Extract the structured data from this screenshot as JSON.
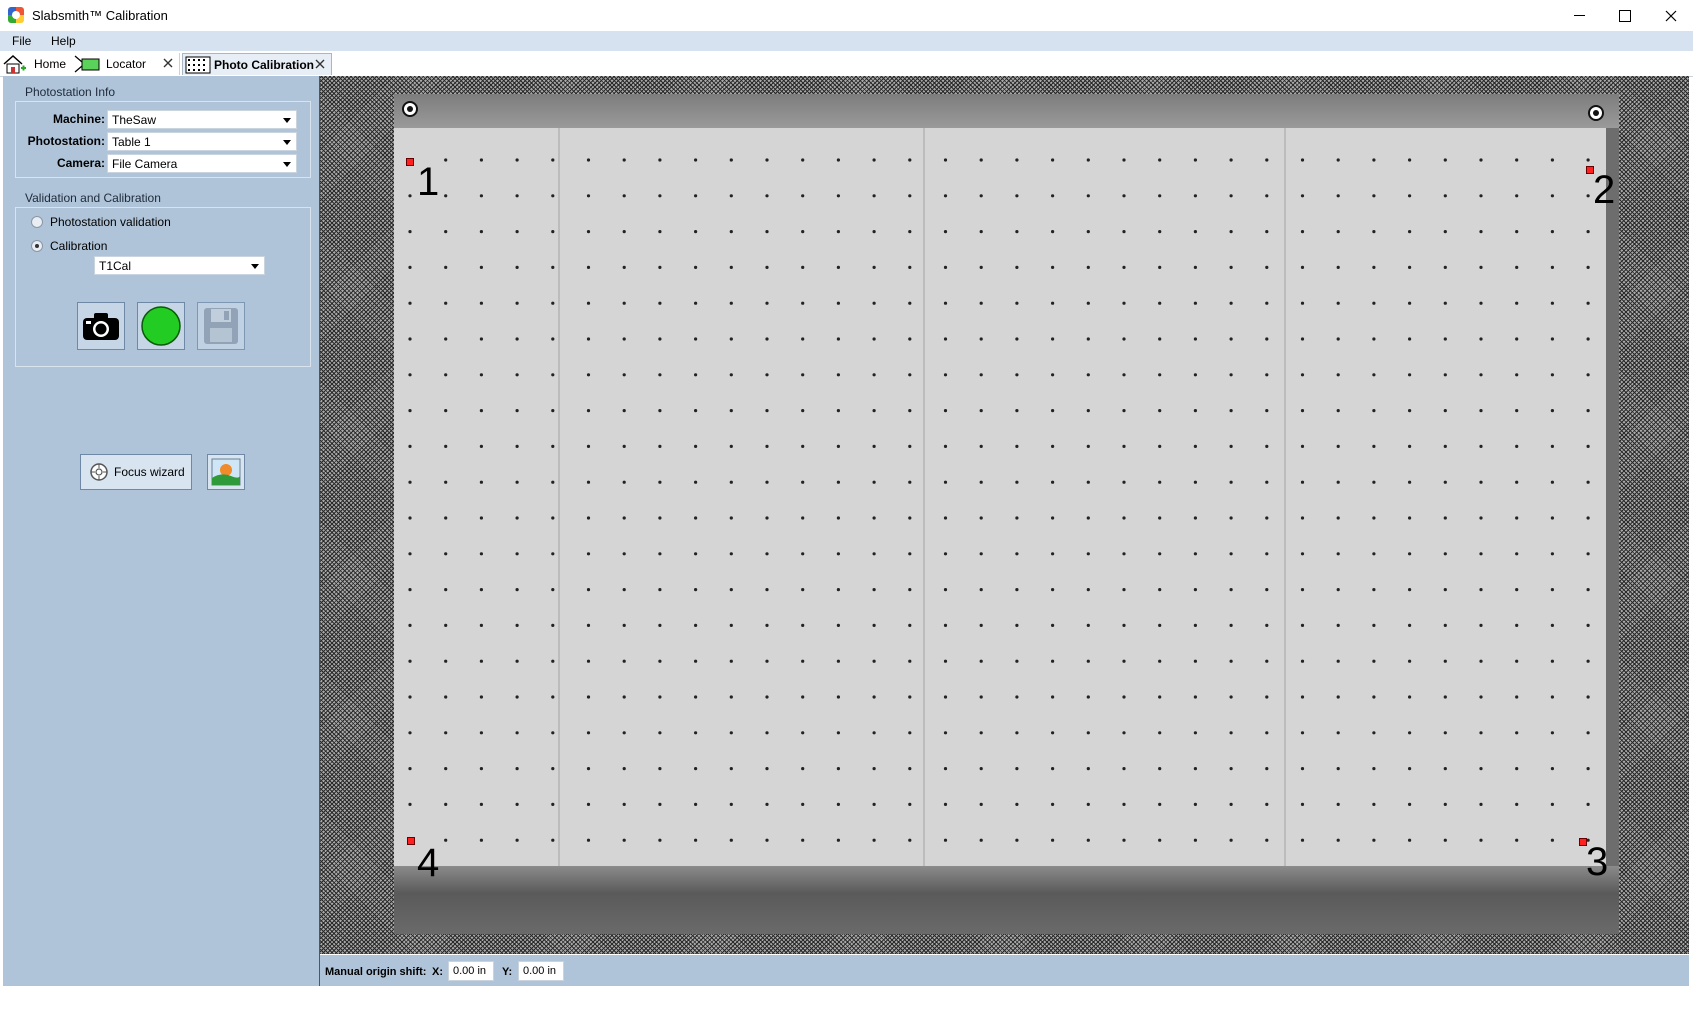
{
  "window": {
    "title": "Slabsmith™ Calibration"
  },
  "menu": {
    "items": [
      "File",
      "Help"
    ]
  },
  "tabs": [
    {
      "label": "Home"
    },
    {
      "label": "Locator"
    },
    {
      "label": "Photo Calibration"
    }
  ],
  "photostation_info": {
    "title": "Photostation Info",
    "machine_label": "Machine:",
    "machine_value": "TheSaw",
    "photostation_label": "Photostation:",
    "photostation_value": "Table 1",
    "camera_label": "Camera:",
    "camera_value": "File Camera"
  },
  "validation": {
    "title": "Validation and Calibration",
    "option_validation": "Photostation validation",
    "option_calibration": "Calibration",
    "selected_option": "Calibration",
    "calibration_value": "T1Cal"
  },
  "actions": {
    "focus_wizard_label": "Focus wizard"
  },
  "viewer": {
    "corner_labels": [
      "1",
      "2",
      "3",
      "4"
    ]
  },
  "origin_shift": {
    "label": "Manual origin shift:",
    "x_label": "X:",
    "x_value": "0.00 in",
    "y_label": "Y:",
    "y_value": "0.00 in"
  },
  "colors": {
    "panel": "#afc4d9",
    "marker": "#ff2020",
    "record_button": "#22cc22"
  }
}
